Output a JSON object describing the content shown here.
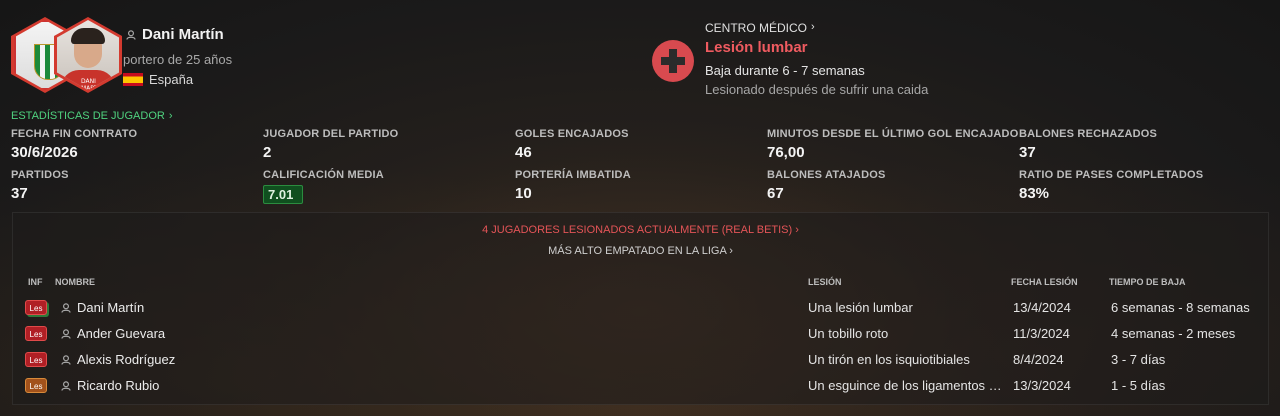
{
  "player": {
    "name": "Dani Martín",
    "subtitle": "portero de 25 años",
    "nation": "España",
    "shirt_tag": "DANI MARTÍN"
  },
  "medical": {
    "heading": "CENTRO MÉDICO",
    "injury": "Lesión lumbar",
    "duration": "Baja durante 6 - 7 semanas",
    "cause": "Lesionado después de sufrir una caida"
  },
  "stats": {
    "link": "ESTADÍSTICAS DE JUGADOR",
    "items": [
      {
        "label": "FECHA FIN CONTRATO",
        "value": "30/6/2026"
      },
      {
        "label": "JUGADOR DEL PARTIDO",
        "value": "2"
      },
      {
        "label": "GOLES ENCAJADOS",
        "value": "46"
      },
      {
        "label": "MINUTOS DESDE EL ÚLTIMO GOL ENCAJADO",
        "value": "76,00"
      },
      {
        "label": "BALONES RECHAZADOS",
        "value": "37"
      },
      {
        "label": "PARTIDOS",
        "value": "37"
      },
      {
        "label": "CALIFICACIÓN MEDIA",
        "value": "7.01"
      },
      {
        "label": "PORTERÍA IMBATIDA",
        "value": "10"
      },
      {
        "label": "BALONES ATAJADOS",
        "value": "67"
      },
      {
        "label": "RATIO DE PASES COMPLETADOS",
        "value": "83%"
      }
    ]
  },
  "injuries": {
    "summary_link": "4 JUGADORES LESIONADOS ACTUALMENTE (REAL BETIS)",
    "league_link": "MÁS ALTO EMPATADO EN LA LIGA",
    "columns": {
      "inf": "INF",
      "name": "NOMBRE",
      "lesion": "LESIÓN",
      "fecha": "FECHA LESIÓN",
      "tiempo": "TIEMPO DE BAJA"
    },
    "rows": [
      {
        "inf": "Les",
        "severity": "red",
        "name": "Dani Martín",
        "lesion": "Una lesión lumbar",
        "fecha": "13/4/2024",
        "tiempo": "6 semanas - 8 semanas"
      },
      {
        "inf": "Les",
        "severity": "red",
        "name": "Ander Guevara",
        "lesion": "Un tobillo roto",
        "fecha": "11/3/2024",
        "tiempo": "4 semanas - 2 meses"
      },
      {
        "inf": "Les",
        "severity": "red",
        "name": "Alexis Rodríguez",
        "lesion": "Un tirón en los isquiotibiales",
        "fecha": "8/4/2024",
        "tiempo": "3 - 7 días"
      },
      {
        "inf": "Les",
        "severity": "orange",
        "name": "Ricardo Rubio",
        "lesion": "Un esguince de los ligamentos del tobillo",
        "fecha": "13/3/2024",
        "tiempo": "1 - 5 días"
      }
    ]
  },
  "colors": {
    "accent_red": "#ef5b60",
    "accent_green": "#4fd27f",
    "rating_bg": "#104f1f"
  }
}
